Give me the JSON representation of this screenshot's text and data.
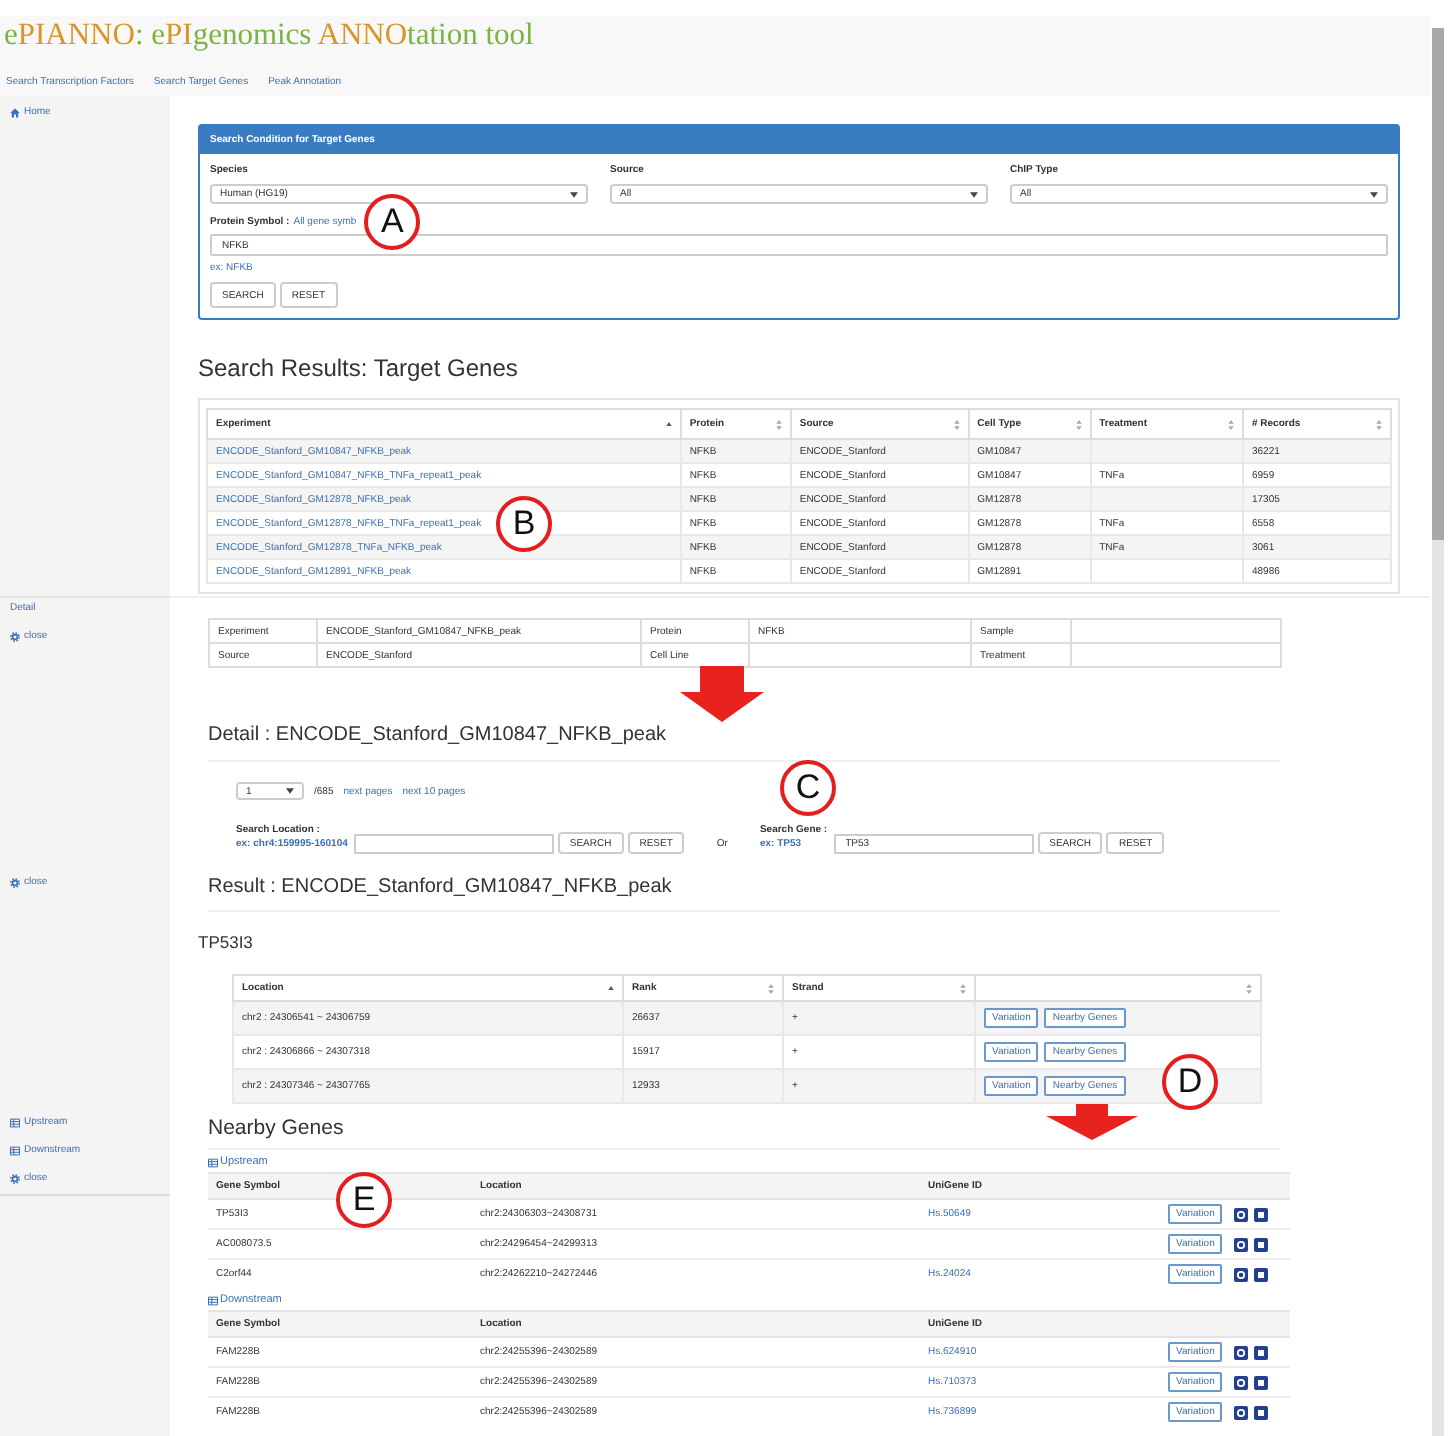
{
  "header": {
    "title": [
      {
        "text": "e",
        "color": "#7cb342"
      },
      {
        "text": "PIANNO",
        "color": "#d9962b"
      },
      {
        "text": ": e",
        "color": "#7cb342"
      },
      {
        "text": "PI",
        "color": "#d9962b"
      },
      {
        "text": "genomics ",
        "color": "#7cb342"
      },
      {
        "text": "ANNO",
        "color": "#d9962b"
      },
      {
        "text": "tation tool",
        "color": "#7cb342"
      }
    ],
    "nav": [
      "Search Transcription Factors",
      "Search Target Genes",
      "Peak Annotation"
    ]
  },
  "search_screen": {
    "sidebar": [
      {
        "kind": "home",
        "label": "Home"
      }
    ],
    "search_panel": {
      "title": "Search Condition for Target Genes",
      "filters": [
        {
          "label": "Species",
          "value": "Human (HG19)"
        },
        {
          "label": "Source",
          "value": "All"
        },
        {
          "label": "ChIP Type",
          "value": "All"
        }
      ],
      "protein_label": "Protein Symbol :",
      "gene_list_link": "All gene symb",
      "marker": "A",
      "protein_value": "NFKB",
      "example": "ex: NFKB",
      "buttons": [
        "SEARCH",
        "RESET"
      ]
    },
    "results": {
      "heading": "Search Results: Target Genes",
      "marker": "B",
      "columns": [
        {
          "label": "Experiment",
          "sorted": true
        },
        {
          "label": "Protein",
          "sorted": false
        },
        {
          "label": "Source",
          "sorted": false
        },
        {
          "label": "Cell Type",
          "sorted": false
        },
        {
          "label": "Treatment",
          "sorted": false
        },
        {
          "label": "# Records",
          "sorted": false
        }
      ],
      "rows": [
        {
          "experiment": "ENCODE_Stanford_GM10847_NFKB_peak",
          "protein": "NFKB",
          "source": "ENCODE_Stanford",
          "cell_type": "GM10847",
          "records": "36221"
        },
        {
          "experiment": "ENCODE_Stanford_GM10847_NFKB_TNFa_repeat1_peak",
          "protein": "NFKB",
          "source": "ENCODE_Stanford",
          "cell_type": "GM10847",
          "treatment": "TNFa",
          "records": "6959"
        },
        {
          "experiment": "ENCODE_Stanford_GM12878_NFKB_peak",
          "protein": "NFKB",
          "source": "ENCODE_Stanford",
          "cell_type": "GM12878",
          "records": "17305"
        },
        {
          "experiment": "ENCODE_Stanford_GM12878_NFKB_TNFa_repeat1_peak",
          "protein": "NFKB",
          "source": "ENCODE_Stanford",
          "cell_type": "GM12878",
          "treatment": "TNFa",
          "records": "6558"
        },
        {
          "experiment": "ENCODE_Stanford_GM12878_TNFa_NFKB_peak",
          "protein": "NFKB",
          "source": "ENCODE_Stanford",
          "cell_type": "GM12878",
          "treatment": "TNFa",
          "records": "3061"
        },
        {
          "experiment": "ENCODE_Stanford_GM12891_NFKB_peak",
          "protein": "NFKB",
          "source": "ENCODE_Stanford",
          "cell_type": "GM12891",
          "records": "48986"
        }
      ]
    }
  },
  "detail_screen": {
    "sidebar": [
      {
        "kind": "plain",
        "label": "Detail"
      },
      {
        "kind": "gear",
        "label": "close"
      }
    ],
    "info": [
      {
        "label": "Experiment",
        "value": "ENCODE_Stanford_GM10847_NFKB_peak"
      },
      {
        "label": "Protein",
        "value": "NFKB"
      },
      {
        "label": "Sample"
      },
      {
        "label": "Source",
        "value": "ENCODE_Stanford"
      },
      {
        "label": "Cell Line"
      },
      {
        "label": "Treatment"
      }
    ],
    "heading": "Detail : ENCODE_Stanford_GM10847_NFKB_peak",
    "pagination": {
      "page": "1",
      "total": "/685",
      "links": [
        "next pages",
        "next 10 pages"
      ]
    },
    "marker": "C",
    "location_search": {
      "label": "Search Location :",
      "example": "ex: chr4:159995-160104",
      "buttons": [
        "SEARCH",
        "RESET"
      ]
    },
    "separator": "Or",
    "gene_search": {
      "label": "Search Gene :",
      "example": "ex: TP53",
      "value": "TP53",
      "buttons": [
        "SEARCH",
        "RESET"
      ]
    }
  },
  "result_screen": {
    "sidebar": [
      {
        "kind": "gear",
        "label": "close"
      }
    ],
    "heading": "Result : ENCODE_Stanford_GM10847_NFKB_peak",
    "gene": "TP53I3",
    "marker": "D",
    "columns": [
      {
        "label": "Location",
        "sorted": true
      },
      {
        "label": "Rank",
        "sorted": false
      },
      {
        "label": "Strand",
        "sorted": false
      },
      {
        "sorted": false
      }
    ],
    "rows": [
      {
        "location": "chr2 : 24306541 ~ 24306759",
        "rank": "26637",
        "strand": "+",
        "buttons": [
          "Variation",
          "Nearby Genes"
        ]
      },
      {
        "location": "chr2 : 24306866 ~ 24307318",
        "rank": "15917",
        "strand": "+",
        "buttons": [
          "Variation",
          "Nearby Genes"
        ]
      },
      {
        "location": "chr2 : 24307346 ~ 24307765",
        "rank": "12933",
        "strand": "+",
        "buttons": [
          "Variation",
          "Nearby Genes"
        ]
      }
    ]
  },
  "nearby_screen": {
    "sidebar": [
      {
        "kind": "table",
        "label": "Upstream"
      },
      {
        "kind": "table",
        "label": "Downstream"
      },
      {
        "kind": "gear",
        "label": "close"
      }
    ],
    "heading": "Nearby Genes",
    "marker": "E",
    "groups": [
      {
        "title": "Upstream",
        "columns": [
          "Gene Symbol",
          "Location",
          "UniGene ID"
        ],
        "rows": [
          {
            "symbol": "TP53I3",
            "location": "chr2:24306303~24308731",
            "unigene": "Hs.50649",
            "button": "Variation"
          },
          {
            "symbol": "AC008073.5",
            "location": "chr2:24296454~24299313",
            "button": "Variation"
          },
          {
            "symbol": "C2orf44",
            "location": "chr2:24262210~24272446",
            "unigene": "Hs.24024",
            "button": "Variation"
          }
        ]
      },
      {
        "title": "Downstream",
        "columns": [
          "Gene Symbol",
          "Location",
          "UniGene ID"
        ],
        "rows": [
          {
            "symbol": "FAM228B",
            "location": "chr2:24255396~24302589",
            "unigene": "Hs.624910",
            "button": "Variation"
          },
          {
            "symbol": "FAM228B",
            "location": "chr2:24255396~24302589",
            "unigene": "Hs.710373",
            "button": "Variation"
          },
          {
            "symbol": "FAM228B",
            "location": "chr2:24255396~24302589",
            "unigene": "Hs.736899",
            "button": "Variation"
          }
        ]
      }
    ]
  }
}
